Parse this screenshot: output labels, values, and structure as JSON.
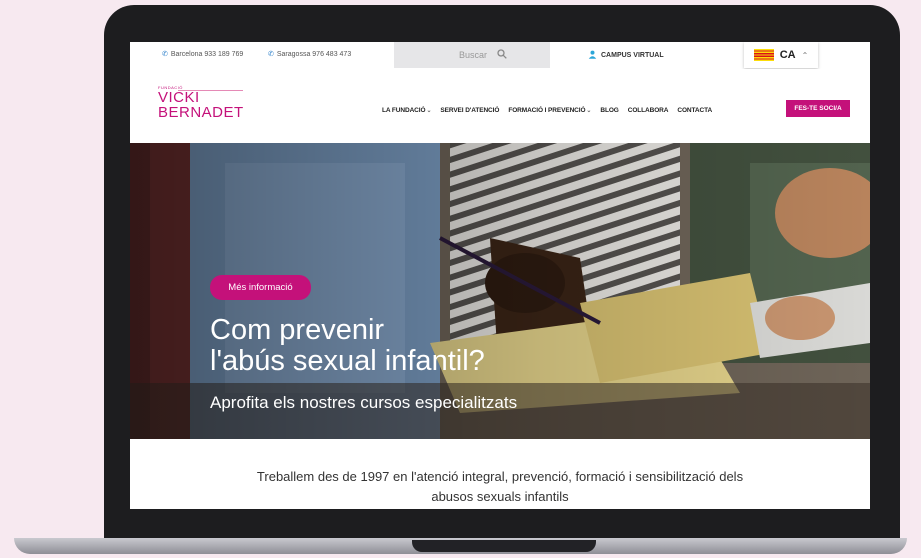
{
  "topbar": {
    "phone_barcelona": "Barcelona 933 189 769",
    "phone_saragossa": "Saragossa 976 483 473",
    "search_placeholder": "Buscar",
    "campus_label": "CAMPUS VIRTUAL",
    "language_code": "CA"
  },
  "header": {
    "logo_small": "FUNDACIÓ",
    "logo_line1": "VICKI",
    "logo_line2": "BERNADET"
  },
  "nav": {
    "items": [
      {
        "label": "LA FUNDACIÓ",
        "dropdown": true
      },
      {
        "label": "SERVEI D'ATENCIÓ",
        "dropdown": false
      },
      {
        "label": "FORMACIÓ I PREVENCIÓ",
        "dropdown": true
      },
      {
        "label": "BLOG",
        "dropdown": false
      },
      {
        "label": "COLLABORA",
        "dropdown": false
      },
      {
        "label": "CONTACTA",
        "dropdown": false
      }
    ],
    "cta_label": "FES-TE SOCI/A"
  },
  "hero": {
    "pill_label": "Més informació",
    "title_line1": "Com prevenir",
    "title_line2": "l'abús sexual infantil?",
    "subtitle": "Aprofita els nostres cursos especialitzats"
  },
  "intro": {
    "line1": "Treballem des de 1997 en l'atenció integral, prevenció, formació i sensibilització dels",
    "line2": "abusos sexuals infantils"
  },
  "colors": {
    "brand": "#c4117a",
    "page_background": "#f7e9f0",
    "laptop_frame": "#1d1d1f"
  }
}
